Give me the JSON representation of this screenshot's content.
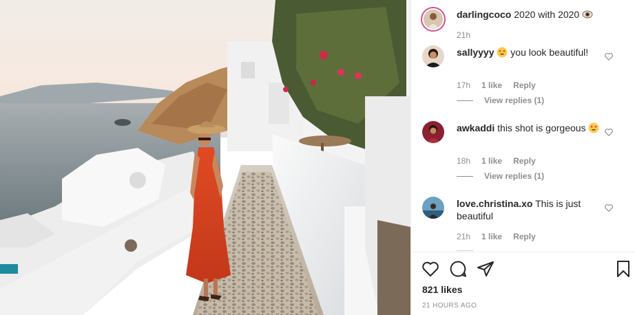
{
  "post": {
    "author": "darlingcoco",
    "caption": "2020 with 2020",
    "caption_emoji": "eyes-emoji",
    "time": "21h"
  },
  "comments": [
    {
      "username": "sallyyyy",
      "emoji": "heart-eyes-emoji",
      "text": "you look beautiful!",
      "time": "17h",
      "likes": "1 like",
      "reply": "Reply",
      "view_replies": "View replies (1)"
    },
    {
      "username": "awkaddi",
      "text": "this shot is gorgeous",
      "emoji": "heart-eyes-emoji",
      "time": "18h",
      "likes": "1 like",
      "reply": "Reply",
      "view_replies": "View replies (1)"
    },
    {
      "username": "love.christina.xo",
      "text": "This is just beautiful",
      "time": "21h",
      "likes": "1 like",
      "reply": "Reply"
    }
  ],
  "actions": {
    "like_icon": "heart-icon",
    "comment_icon": "comment-icon",
    "share_icon": "share-icon",
    "save_icon": "bookmark-icon"
  },
  "likes_count": "821 likes",
  "posted_ago": "21 HOURS AGO",
  "colors": {
    "story_ring": "#d94f8b",
    "text": "#262626",
    "muted": "#8e8e8e",
    "dress": "#d6431f"
  }
}
